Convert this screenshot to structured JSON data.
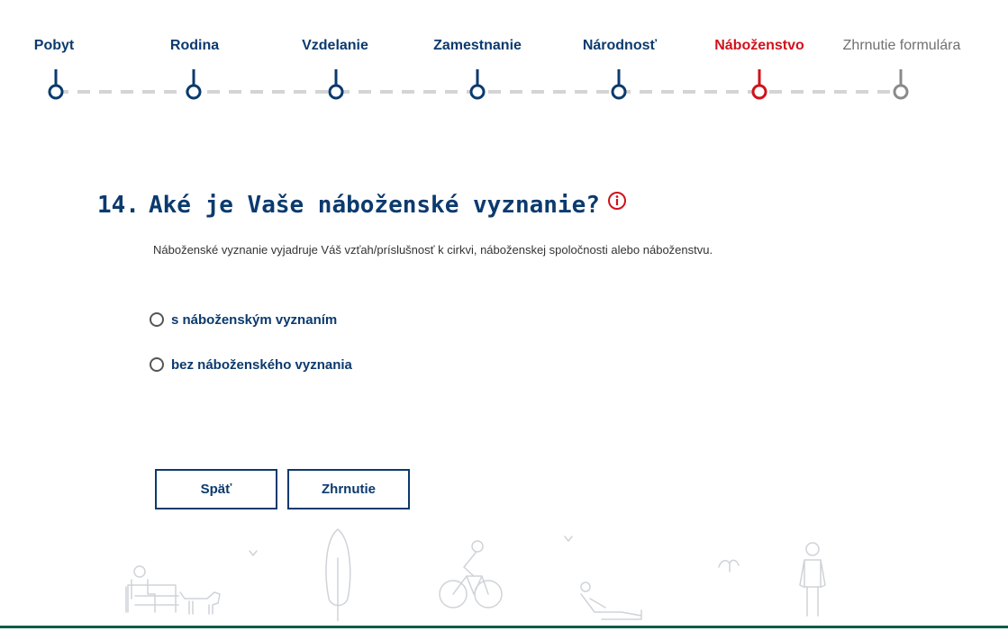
{
  "stepper": {
    "steps": [
      {
        "label": "Pobyt",
        "state": "done"
      },
      {
        "label": "Rodina",
        "state": "done"
      },
      {
        "label": "Vzdelanie",
        "state": "done"
      },
      {
        "label": "Zamestnanie",
        "state": "done"
      },
      {
        "label": "Národnosť",
        "state": "done"
      },
      {
        "label": "Náboženstvo",
        "state": "active"
      },
      {
        "label": "Zhrnutie formulára",
        "state": "todo"
      }
    ]
  },
  "question": {
    "number": "14.",
    "title": "Aké je Vaše náboženské vyznanie?",
    "hint": "Náboženské vyznanie vyjadruje Váš vzťah/príslušnosť k cirkvi, náboženskej spoločnosti alebo náboženstvu.",
    "options": [
      {
        "label": "s náboženským vyznaním",
        "selected": false
      },
      {
        "label": "bez náboženského vyznania",
        "selected": false
      }
    ]
  },
  "buttons": {
    "back": "Späť",
    "summary": "Zhrnutie"
  },
  "colors": {
    "primary": "#0b3a6e",
    "active": "#d0121b",
    "inactive": "#707070",
    "footer_line": "#0e5a4a"
  }
}
